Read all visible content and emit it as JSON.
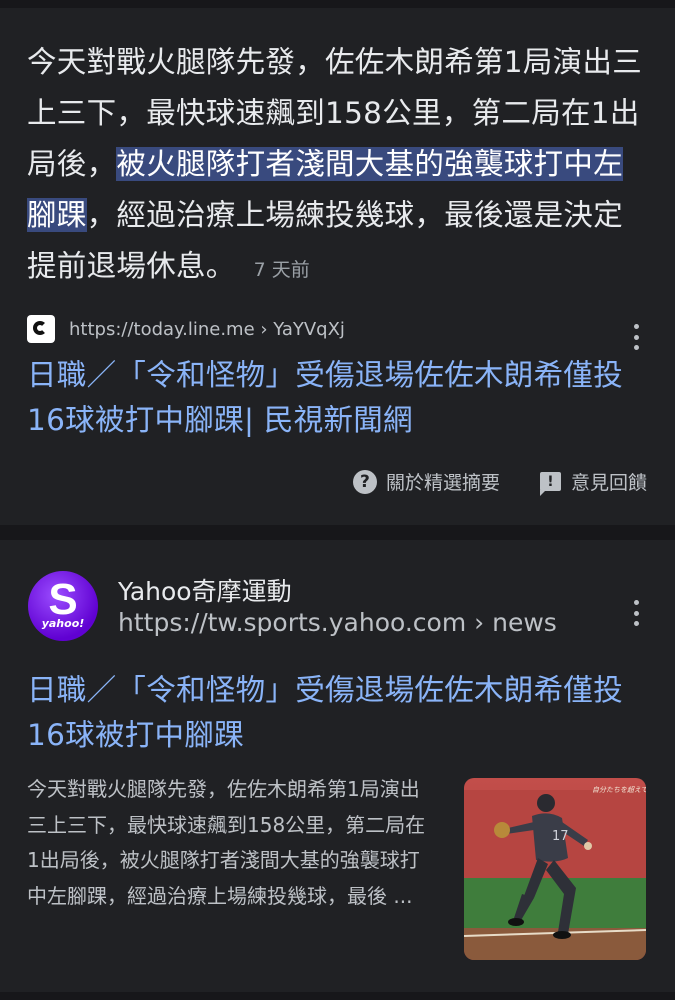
{
  "featured_snippet": {
    "text_before": "今天對戰火腿隊先發，佐佐木朗希第1局演出三上三下，最快球速飆到158公里，第二局在1出局後，",
    "text_highlight": "被火腿隊打者淺間大基的強襲球打中左腳踝",
    "text_after": "，經過治療上場練投幾球，最後還是決定提前退場休息。",
    "age": "7 天前",
    "source_url": "https://today.line.me › YaYVqXj",
    "title": "日職／「令和怪物」受傷退場佐佐木朗希僅投16球被打中腳踝| 民視新聞網",
    "about_label": "關於精選摘要",
    "feedback_label": "意見回饋"
  },
  "result": {
    "site_name": "Yahoo奇摩運動",
    "url": "https://tw.sports.yahoo.com › news",
    "logo_letter": "S",
    "logo_word": "yahoo!",
    "title": "日職／「令和怪物」受傷退場佐佐木朗希僅投16球被打中腳踝",
    "snippet": "今天對戰火腿隊先發，佐佐木朗希第1局演出三上三下，最快球速飆到158公里，第二局在1出局後，被火腿隊打者淺間大基的強襲球打中左腳踝，經過治療上場練投幾球，最後 ...",
    "thumb_caption": "自分たちを超えてゆく。",
    "jersey_number": "17"
  },
  "icons": {
    "favicon": "line-today-icon",
    "about": "help-circle-icon",
    "feedback": "feedback-icon",
    "menu": "more-vert-icon"
  },
  "colors": {
    "page_bg": "#17171a",
    "card_bg": "#202124",
    "link": "#8ab4f8",
    "highlight": "#394a7e",
    "yahoo_purple": "#6001d2"
  }
}
